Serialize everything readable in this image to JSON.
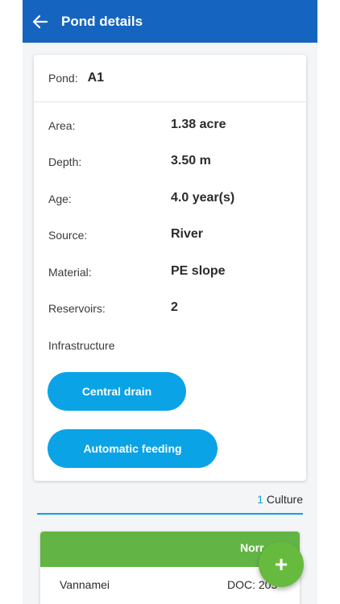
{
  "header": {
    "title": "Pond details",
    "background": "#1565c0"
  },
  "pond": {
    "label": "Pond:",
    "value": "A1"
  },
  "details": [
    {
      "label": "Area:",
      "value": "1.38 acre"
    },
    {
      "label": "Depth:",
      "value": "3.50 m"
    },
    {
      "label": "Age:",
      "value": "4.0 year(s)"
    },
    {
      "label": "Source:",
      "value": "River"
    },
    {
      "label": "Material:",
      "value": "PE slope"
    },
    {
      "label": "Reservoirs:",
      "value": "2"
    }
  ],
  "infrastructure": {
    "label": "Infrastructure",
    "chips": [
      "Central drain",
      "Automatic feeding"
    ],
    "chip_color": "#0aa3e6"
  },
  "culture_summary": {
    "count": "1",
    "label": "Culture"
  },
  "culture_card": {
    "status": "Norr",
    "species": "Vannamei",
    "doc": "DOC: 205",
    "status_color": "#62b544"
  },
  "icons": {
    "back": "arrow-left-icon",
    "fab": "plus-icon"
  },
  "fab": {
    "symbol": "+"
  }
}
